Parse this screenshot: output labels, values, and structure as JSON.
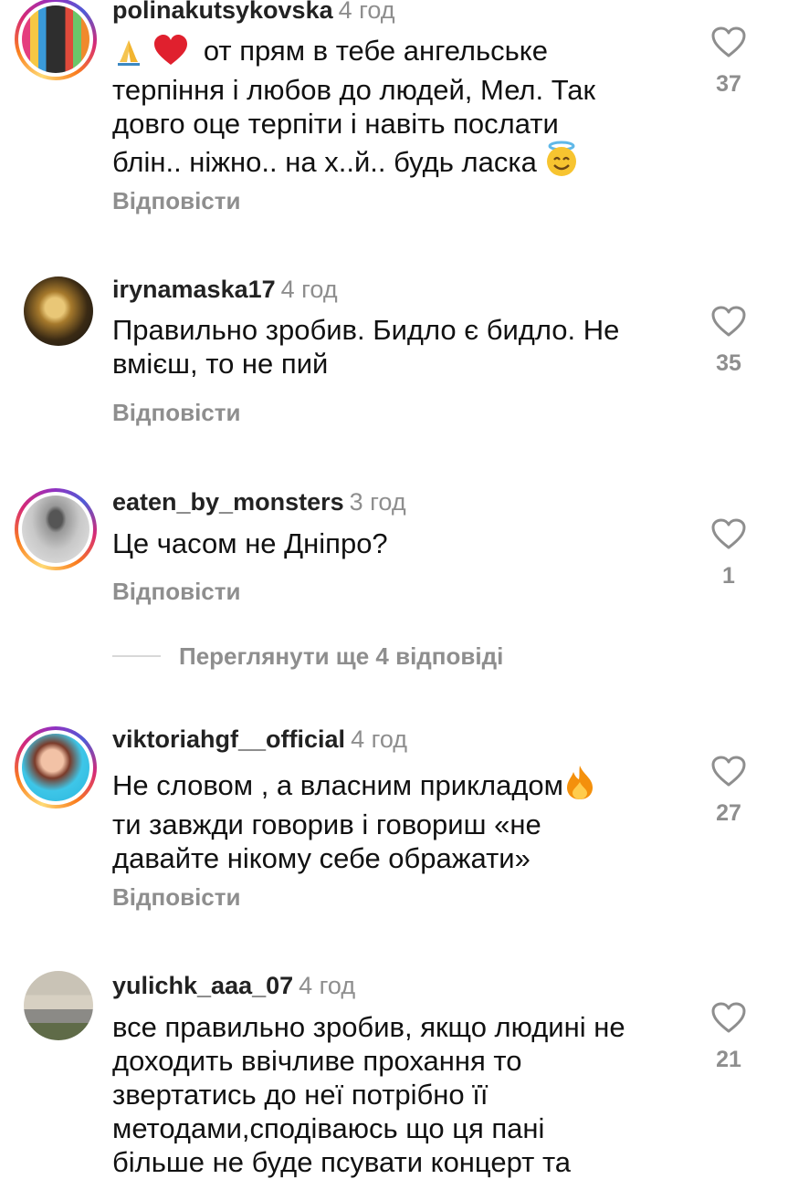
{
  "comments": [
    {
      "username": "polinakutsykovska",
      "time": "4 год",
      "text_lines": [
        "от прям в тебе ангельське",
        "терпіння і любов до людей, Мел. Так",
        "довго оце терпіти і навіть послати",
        "блін.. ніжно.. на х..й.. будь ласка"
      ],
      "reply": "Відповісти",
      "likes": "37"
    },
    {
      "username": "irynamaska17",
      "time": "4 год",
      "text_lines": [
        "Правильно зробив. Бидло є бидло. Не",
        "вмієш, то не пий"
      ],
      "reply": "Відповісти",
      "likes": "35"
    },
    {
      "username": "eaten_by_monsters",
      "time": "3 год",
      "text_lines": [
        "Це часом не Дніпро?"
      ],
      "reply": "Відповісти",
      "likes": "1"
    },
    {
      "username": "viktoriahgf__official",
      "time": "4 год",
      "text_lines": [
        "Не словом , а власним прикладом",
        "ти завжди говорив і говориш «не",
        "давайте нікому себе ображати»"
      ],
      "reply": "Відповісти",
      "likes": "27"
    },
    {
      "username": "yulichk_aaa_07",
      "time": "4 год",
      "text_lines": [
        "все правильно зробив, якщо людині не",
        "доходить ввічливе прохання то",
        "звертатись до неї потрібно її",
        "методами,сподіваюсь що ця пані",
        "більше не буде псувати концерт та"
      ],
      "reply": "",
      "likes": "21"
    }
  ],
  "view_more_replies": "Переглянути ще 4 відповіді",
  "colors": {
    "secondary": "#8e8e8e",
    "divider": "#d8d8d8"
  },
  "icons": [
    "heart-outline-icon",
    "folded-hands-emoji",
    "red-heart-emoji",
    "smiling-face-with-halo-emoji",
    "fire-emoji"
  ]
}
